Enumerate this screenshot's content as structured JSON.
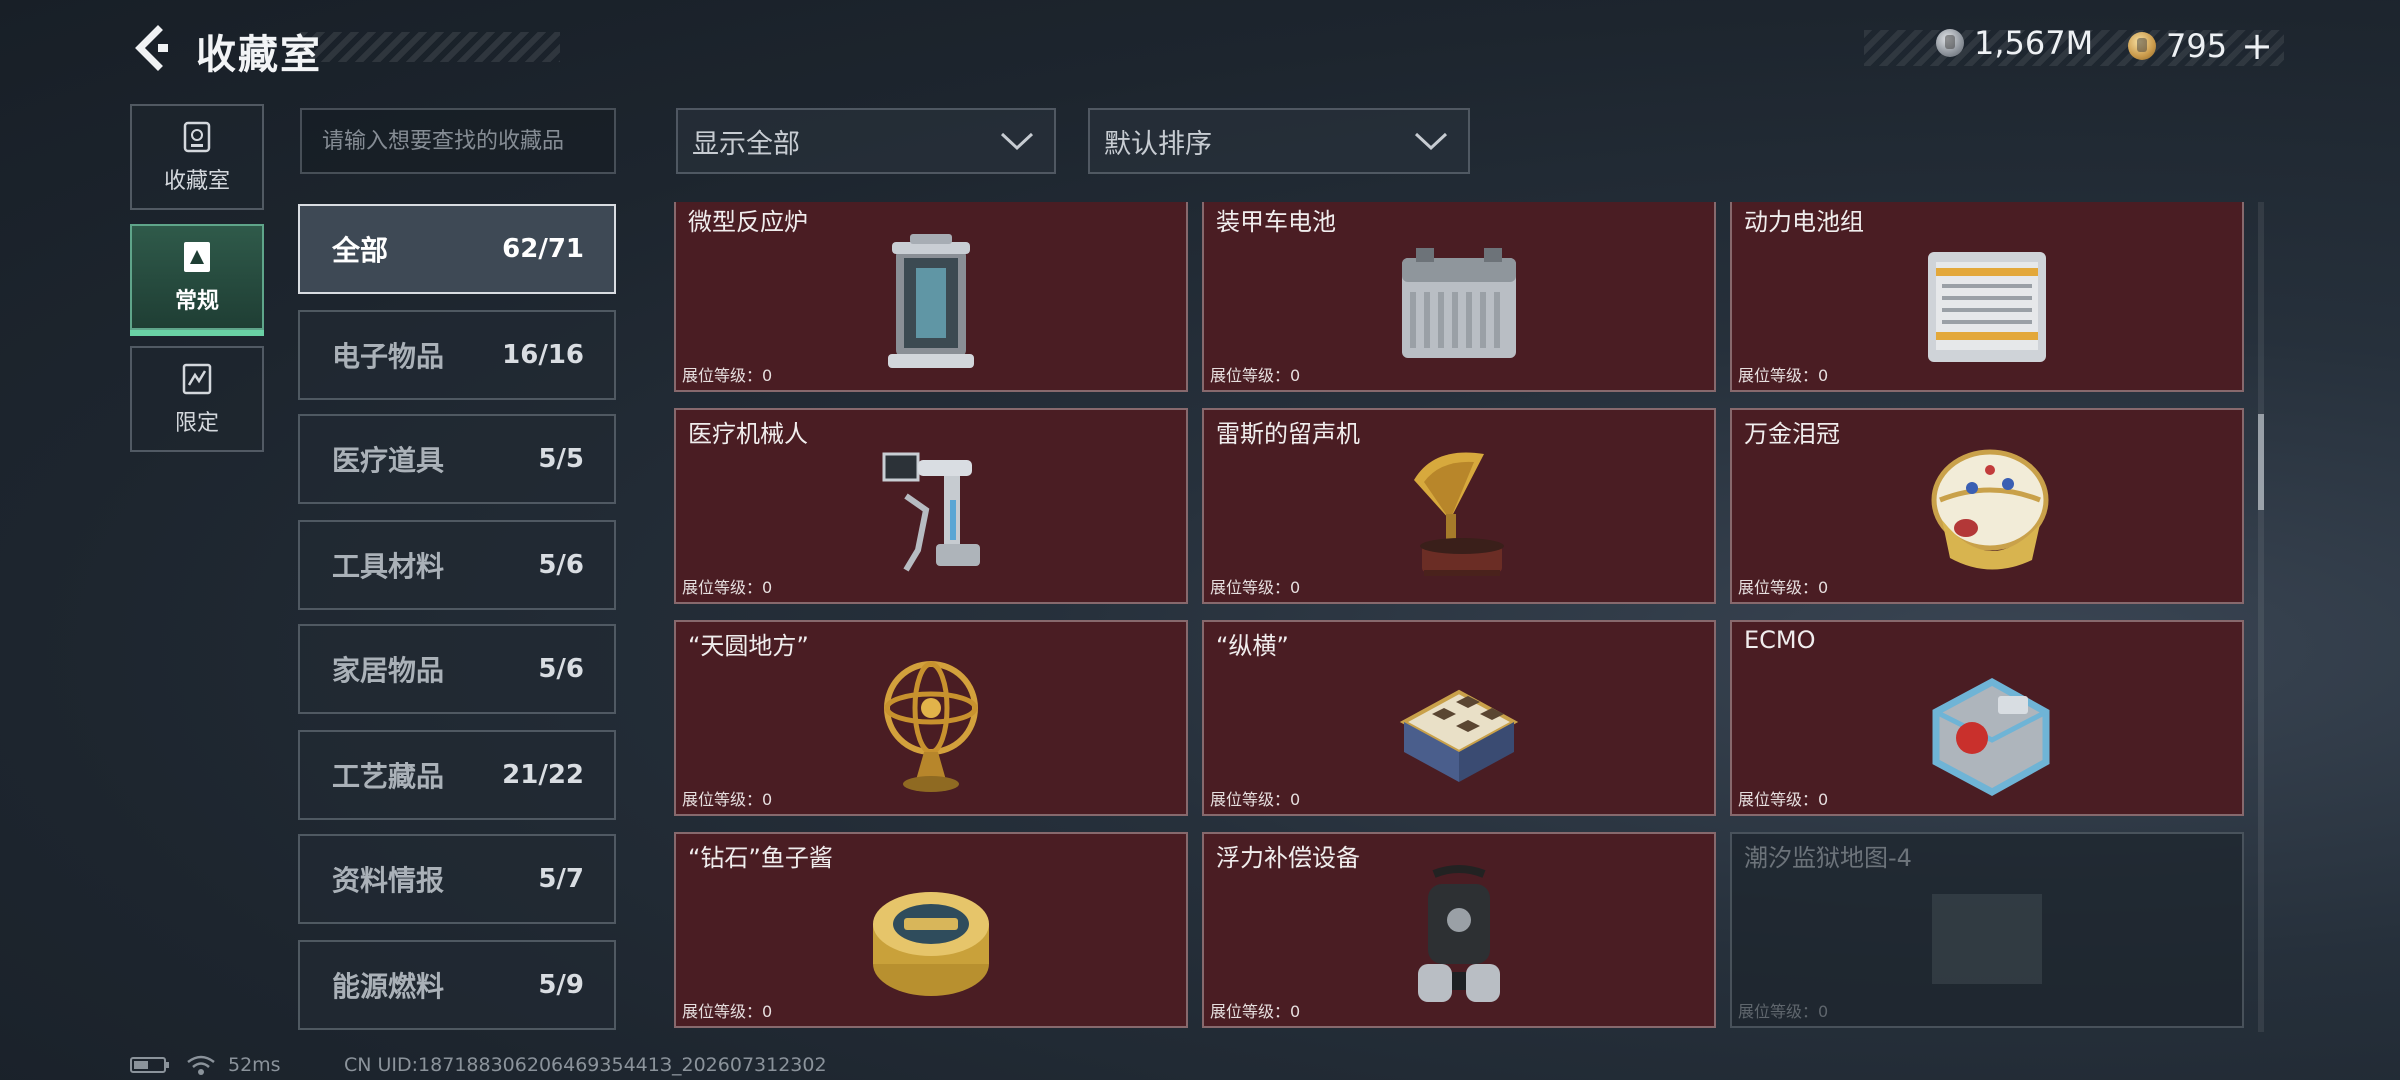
{
  "header": {
    "title": "收藏室"
  },
  "currency": [
    {
      "icon": "silver-coin-icon",
      "value": "1,567M"
    },
    {
      "icon": "gold-coin-icon",
      "value": "795"
    }
  ],
  "currency_plus": "+",
  "nav": [
    {
      "label": "收藏室",
      "icon": "collection-room-icon",
      "active": false
    },
    {
      "label": "常规",
      "icon": "regular-icon",
      "active": true
    },
    {
      "label": "限定",
      "icon": "limited-icon",
      "active": false
    }
  ],
  "search": {
    "placeholder": "请输入想要查找的收藏品"
  },
  "filters": {
    "show": "显示全部",
    "sort": "默认排序"
  },
  "categories": [
    {
      "name": "全部",
      "count": "62/71",
      "active": true
    },
    {
      "name": "电子物品",
      "count": "16/16"
    },
    {
      "name": "医疗道具",
      "count": "5/5"
    },
    {
      "name": "工具材料",
      "count": "5/6"
    },
    {
      "name": "家居物品",
      "count": "5/6"
    },
    {
      "name": "工艺藏品",
      "count": "21/22"
    },
    {
      "name": "资料情报",
      "count": "5/7"
    },
    {
      "name": "能源燃料",
      "count": "5/9"
    }
  ],
  "level_label": "展位等级：",
  "items": [
    {
      "name": "微型反应炉",
      "level": "0",
      "icon": "micro-reactor-icon",
      "owned": true
    },
    {
      "name": "装甲车电池",
      "level": "0",
      "icon": "armored-vehicle-battery-icon",
      "owned": true
    },
    {
      "name": "动力电池组",
      "level": "0",
      "icon": "power-battery-pack-icon",
      "owned": true
    },
    {
      "name": "医疗机械人",
      "level": "0",
      "icon": "medical-robot-icon",
      "owned": true
    },
    {
      "name": "雷斯的留声机",
      "level": "0",
      "icon": "gramophone-icon",
      "owned": true
    },
    {
      "name": "万金泪冠",
      "level": "0",
      "icon": "jeweled-egg-crown-icon",
      "owned": true
    },
    {
      "name": "“天圆地方”",
      "level": "0",
      "icon": "armillary-sphere-icon",
      "owned": true
    },
    {
      "name": "“纵横”",
      "level": "0",
      "icon": "chess-box-icon",
      "owned": true
    },
    {
      "name": "ECMO",
      "level": "0",
      "icon": "ecmo-machine-icon",
      "owned": true
    },
    {
      "name": "“钻石”鱼子酱",
      "level": "0",
      "icon": "caviar-tin-icon",
      "owned": true
    },
    {
      "name": "浮力补偿设备",
      "level": "0",
      "icon": "buoyancy-compensator-icon",
      "owned": true
    },
    {
      "name": "潮汐监狱地图-4",
      "level": "0",
      "icon": "map-icon",
      "owned": false
    }
  ],
  "footer": {
    "ping": "52ms",
    "uid": "CN UID:18718830620646935441З_202607312302"
  }
}
